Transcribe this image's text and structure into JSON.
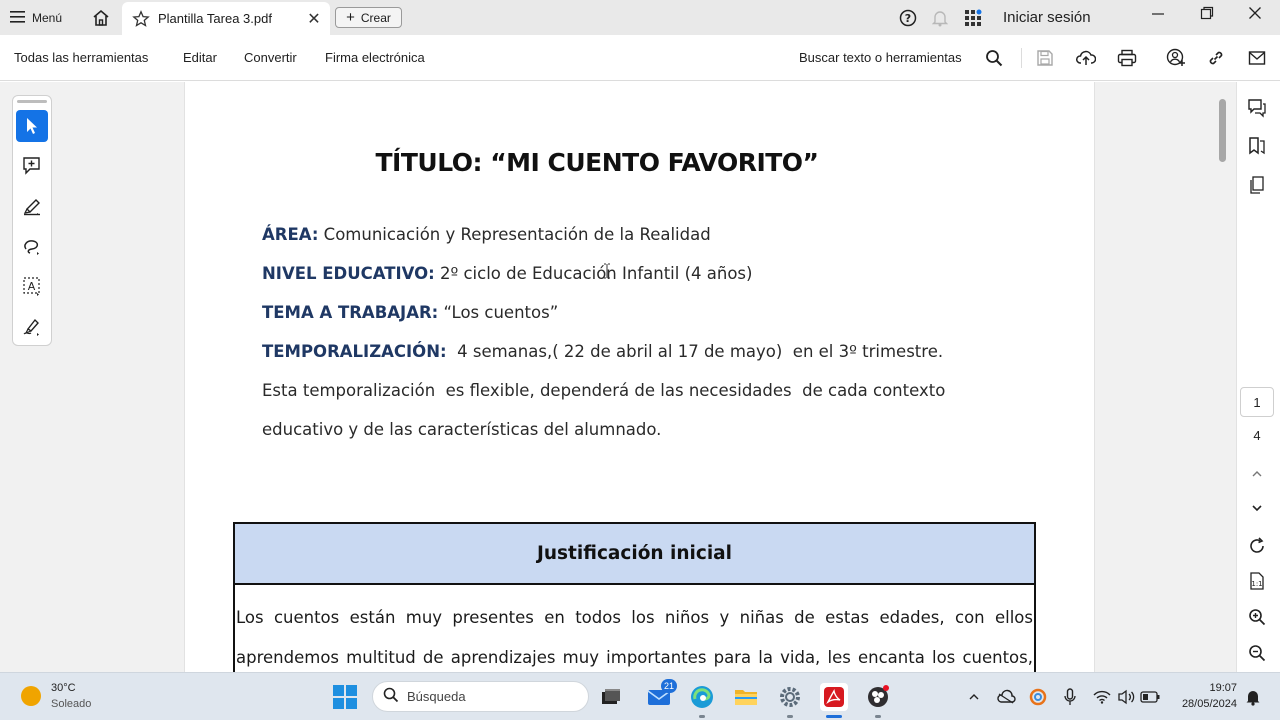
{
  "titlebar": {
    "menu_label": "Menú",
    "tab_label": "Plantilla Tarea 3.pdf",
    "create_label": "Crear",
    "signin_label": "Iniciar sesión"
  },
  "toolbar": {
    "all_tools": "Todas las herramientas",
    "edit": "Editar",
    "convert": "Convertir",
    "esign": "Firma electrónica",
    "search_tools": "Buscar texto o herramientas"
  },
  "document": {
    "title": "TÍTULO: “MI CUENTO FAVORITO”",
    "area_label": "ÁREA:",
    "area_value": " Comunicación y Representación de la Realidad",
    "level_label": "NIVEL EDUCATIVO:",
    "level_value": " 2º ciclo de Educación Infantil (4 años)",
    "theme_label": "TEMA A TRABAJAR:",
    "theme_value": " “Los cuentos”",
    "timing_label": "TEMPORALIZACIÓN:",
    "timing_value": "  4 semanas,( 22 de abril al 17 de mayo)  en el 3º trimestre.",
    "timing_note_1": "Esta temporalización  es flexible, dependerá de las necesidades  de cada contexto",
    "timing_note_2": "educativo y de las características del alumnado.",
    "justification_title": "Justificación inicial",
    "justification_line_1": "Los cuentos están muy presentes en todos los niños y niñas de estas edades, con ellos",
    "justification_line_2": "aprendemos multitud de aprendizajes muy importantes para la vida, les encanta los cuentos,"
  },
  "pagination": {
    "current_page": "1",
    "total_pages": "4"
  },
  "taskbar": {
    "weather_temp": "30°C",
    "weather_desc": "Soleado",
    "search_placeholder": "Búsqueda",
    "mail_badge": "21",
    "time": "19:07",
    "date": "28/05/2024"
  },
  "colors": {
    "accent": "#1473e6",
    "heading_label": "#1f3864",
    "table_header_bg": "#c9d9f2",
    "acrobat_red": "#d71920"
  }
}
